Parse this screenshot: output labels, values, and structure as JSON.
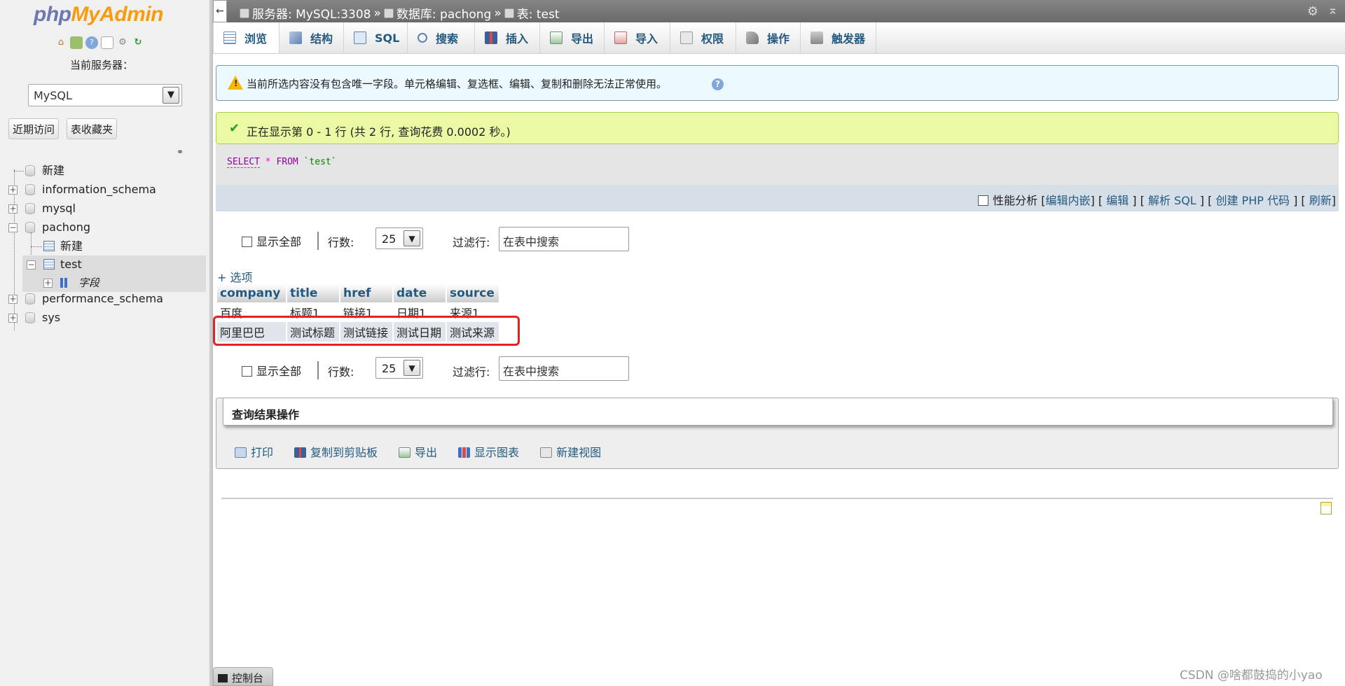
{
  "nav": {
    "logo_php": "php",
    "logo_myadmin": "MyAdmin",
    "server_label": "当前服务器：",
    "server_value": "MySQL",
    "recent_button": "近期访问",
    "favorites_button": "表收藏夹",
    "tree": {
      "new": "新建",
      "databases": [
        "information_schema",
        "mysql",
        "pachong",
        "performance_schema",
        "sys"
      ],
      "pachong_new": "新建",
      "table": "test",
      "fields": "字段"
    }
  },
  "topbar": {
    "server": "服务器: MySQL:3308",
    "database": "数据库: pachong",
    "table": "表: test",
    "sep": "»"
  },
  "tabs": [
    {
      "label": "浏览",
      "icon": "browse-icon"
    },
    {
      "label": "结构",
      "icon": "structure-icon"
    },
    {
      "label": "SQL",
      "icon": "sql-icon"
    },
    {
      "label": "搜索",
      "icon": "search-icon"
    },
    {
      "label": "插入",
      "icon": "insert-icon"
    },
    {
      "label": "导出",
      "icon": "export-icon"
    },
    {
      "label": "导入",
      "icon": "import-icon"
    },
    {
      "label": "权限",
      "icon": "privileges-icon"
    },
    {
      "label": "操作",
      "icon": "operations-icon"
    },
    {
      "label": "触发器",
      "icon": "triggers-icon"
    }
  ],
  "notice": "当前所选内容没有包含唯一字段。单元格编辑、复选框、编辑、复制和删除无法正常使用。",
  "success": "正在显示第 0 - 1 行 (共 2 行, 查询花费 0.0002 秒。)",
  "sql": {
    "kw1": "SELECT",
    "star": "*",
    "kw2": "FROM",
    "table": "`test`"
  },
  "sqlbar": {
    "profiling": "性能分析",
    "edit_inline": "编辑内嵌",
    "edit": "编辑",
    "explain": "解析 SQL",
    "php_code": "创建 PHP 代码",
    "refresh": "刷新"
  },
  "pager": {
    "show_all": "显示全部",
    "rows_label": "行数:",
    "rows_value": "25",
    "filter_label": "过滤行:",
    "filter_placeholder": "在表中搜索"
  },
  "options_link": "+ 选项",
  "results": {
    "columns": [
      "company",
      "title",
      "href",
      "date",
      "source"
    ],
    "rows": [
      [
        "百度",
        "标题1",
        "链接1",
        "日期1",
        "来源1"
      ],
      [
        "阿里巴巴",
        "测试标题",
        "测试链接",
        "测试日期",
        "测试来源"
      ]
    ]
  },
  "ops": {
    "title": "查询结果操作",
    "print": "打印",
    "copy": "复制到剪贴板",
    "export": "导出",
    "chart": "显示图表",
    "view": "新建视图"
  },
  "console_label": "控制台",
  "watermark": "CSDN @啥都鼓捣的小yao"
}
